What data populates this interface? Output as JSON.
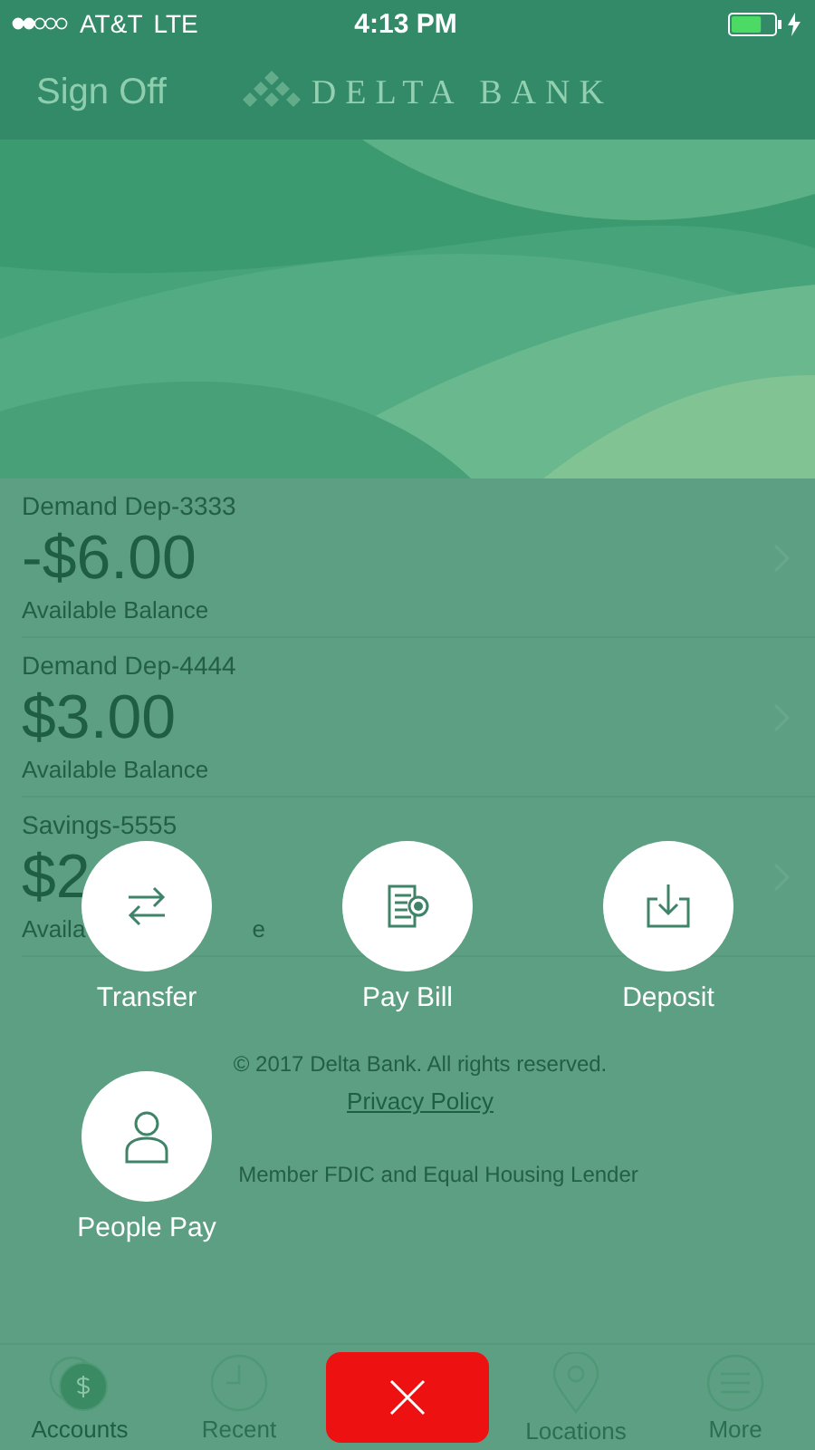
{
  "status_bar": {
    "carrier": "AT&T",
    "network": "LTE",
    "time": "4:13 PM",
    "charging": true,
    "battery": {
      "level": 0.7
    }
  },
  "header": {
    "sign_off": "Sign Off",
    "logo_text": "DELTA BANK"
  },
  "accounts": [
    {
      "name": "Demand Dep-3333",
      "amount": "-$6.00",
      "label_parts": [
        "Available Balance"
      ]
    },
    {
      "name": "Demand Dep-4444",
      "amount": "$3.00",
      "label_parts": [
        "Available Balance"
      ]
    },
    {
      "name": "Savings-5555",
      "amount": "$2",
      "label_parts": [
        "Availa",
        "e"
      ]
    }
  ],
  "footer": {
    "copyright": "© 2017 Delta Bank. All rights reserved.",
    "privacy_link": "Privacy Policy",
    "member": "Member FDIC and Equal Housing Lender"
  },
  "actions": [
    {
      "kind": "transfer",
      "label": "Transfer"
    },
    {
      "kind": "bill",
      "label": "Pay Bill"
    },
    {
      "kind": "deposit",
      "label": "Deposit"
    },
    {
      "kind": "person",
      "label": "People Pay"
    }
  ],
  "tabs": [
    {
      "kind": "accounts",
      "label": "Accounts",
      "selected": true
    },
    {
      "kind": "recent",
      "label": "Recent",
      "selected": false
    },
    {
      "kind": "close"
    },
    {
      "kind": "locations",
      "label": "Locations",
      "selected": false
    },
    {
      "kind": "more",
      "label": "More",
      "selected": false
    }
  ]
}
